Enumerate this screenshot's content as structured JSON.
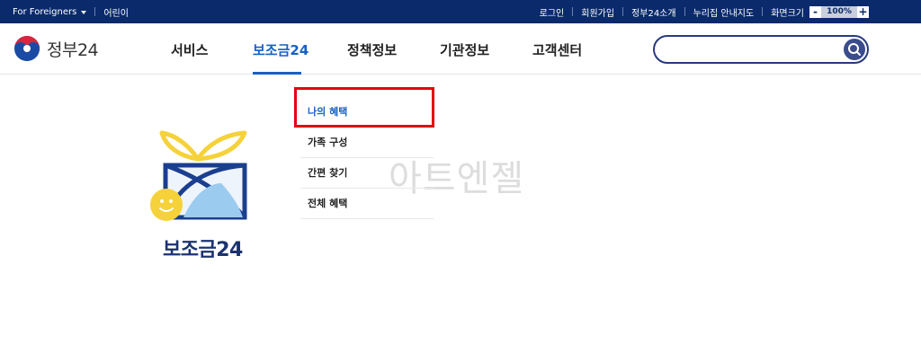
{
  "topbar": {
    "foreigners_label": "For Foreigners",
    "kids_label": "어린이",
    "links": [
      "로그인",
      "회원가입",
      "정부24소개",
      "누리집 안내지도"
    ],
    "zoom_label": "화면크기",
    "zoom_minus": "-",
    "zoom_value": "100%",
    "zoom_plus": "+"
  },
  "header": {
    "logo_text": "정부24",
    "nav": [
      {
        "label": "서비스"
      },
      {
        "label": "보조금24"
      },
      {
        "label": "정책정보"
      },
      {
        "label": "기관정보"
      },
      {
        "label": "고객센터"
      }
    ],
    "search_placeholder": ""
  },
  "submenu": {
    "items": [
      {
        "label": "나의 혜택"
      },
      {
        "label": "가족 구성"
      },
      {
        "label": "간편 찾기"
      },
      {
        "label": "전체 혜택"
      }
    ]
  },
  "hero": {
    "title": "보조금24"
  },
  "watermark": "아트엔젤",
  "colors": {
    "topbar_bg": "#0a2a6b",
    "accent": "#1760c5",
    "highlight": "#e60012"
  }
}
